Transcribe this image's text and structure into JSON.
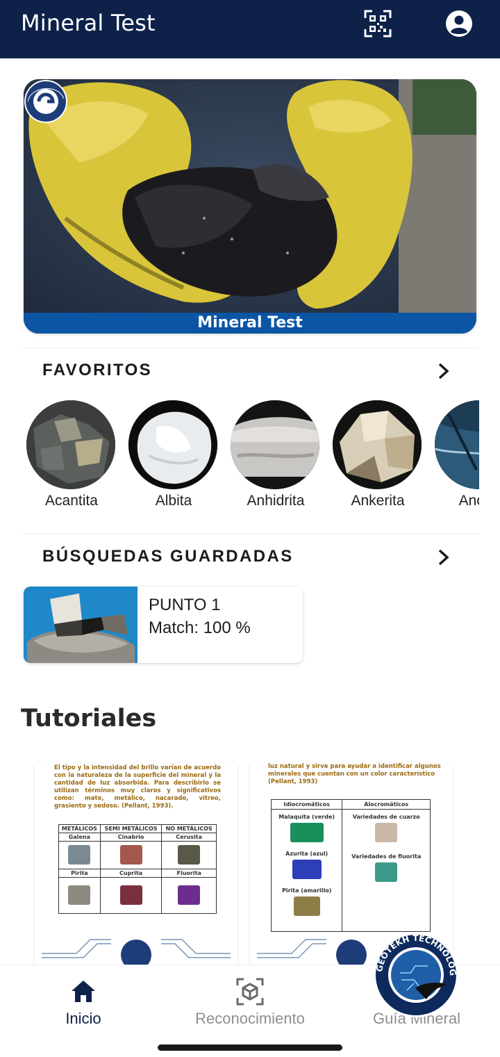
{
  "appbar": {
    "title": "Mineral Test",
    "qr_icon": "qr-code-icon",
    "profile_icon": "account-circle-icon",
    "color": "#0d2149"
  },
  "hero": {
    "caption": "Mineral Test",
    "logo_text": "MINERAL TEST",
    "caption_color": "#0c55a5"
  },
  "favorites": {
    "title": "FAVORITOS",
    "items": [
      {
        "label": "Acantita"
      },
      {
        "label": "Albita"
      },
      {
        "label": "Anhidrita"
      },
      {
        "label": "Ankerita"
      },
      {
        "label": "Anortc"
      }
    ]
  },
  "saved_searches": {
    "title": "BÚSQUEDAS GUARDADAS",
    "items": [
      {
        "name": "PUNTO 1",
        "match": "Match: 100 %"
      }
    ]
  },
  "tutorials": {
    "title": "Tutoriales",
    "card1": {
      "paragraph": "El tipo y la intensidad del brillo varían de acuerdo con la naturaleza de la superficie del mineral y la cantidad de luz absorbida. Para describirlo se utilizan términos muy claros y significativos como: mate, metálico, nacarado, vítreo, grasiento y sedoso. (Pellant, 1993).",
      "headers": [
        "METÁLICOS",
        "SEMI METÁLICOS",
        "NO METÁLICOS"
      ],
      "row1": [
        "Galena",
        "Cinabrio",
        "Cerusita"
      ],
      "row2": [
        "Pirita",
        "Cuprita",
        "Fluorita"
      ]
    },
    "card2": {
      "paragraph": "luz natural y sirve para ayudar a identificar algunos minerales que cuentan con un color característico (Pellant, 1993)",
      "headers": [
        "Idiocromáticos",
        "Alocromáticos"
      ],
      "left": [
        "Malaquita (verde)",
        "Azurita (azul)",
        "Pirita (amarillo)"
      ],
      "right": [
        "Variedades de cuarzo",
        "Variedades de fluorita"
      ]
    }
  },
  "bottom_nav": {
    "items": [
      {
        "label": "Inicio",
        "icon": "home-icon",
        "active": true
      },
      {
        "label": "Reconocimiento",
        "icon": "cube-scan-icon",
        "active": false
      },
      {
        "label": "Guía Mineral",
        "icon": "book-icon",
        "active": false
      }
    ],
    "active_color": "#0d2149",
    "inactive_color": "#8e8e8e"
  },
  "badge": {
    "text": "GEOTEKH TECHNOLOGIES"
  }
}
